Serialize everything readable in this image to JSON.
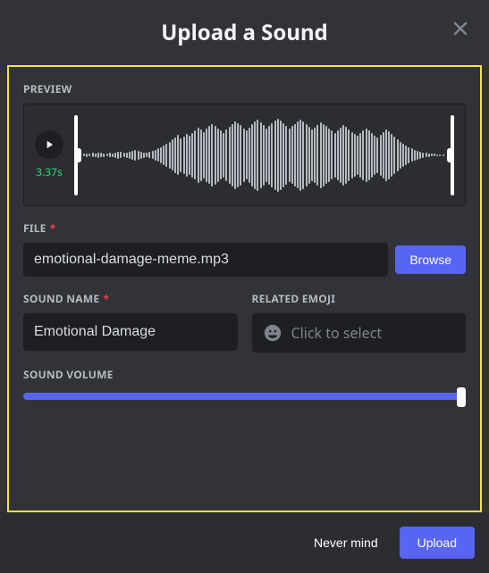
{
  "modal": {
    "title": "Upload a Sound"
  },
  "preview": {
    "label": "PREVIEW",
    "duration": "3.37s"
  },
  "file": {
    "label": "FILE",
    "value": "emotional-damage-meme.mp3",
    "browse_label": "Browse"
  },
  "sound_name": {
    "label": "SOUND NAME",
    "value": "Emotional Damage"
  },
  "emoji": {
    "label": "RELATED EMOJI",
    "placeholder": "Click to select"
  },
  "volume": {
    "label": "SOUND VOLUME",
    "value": 100
  },
  "footer": {
    "cancel_label": "Never mind",
    "upload_label": "Upload"
  }
}
